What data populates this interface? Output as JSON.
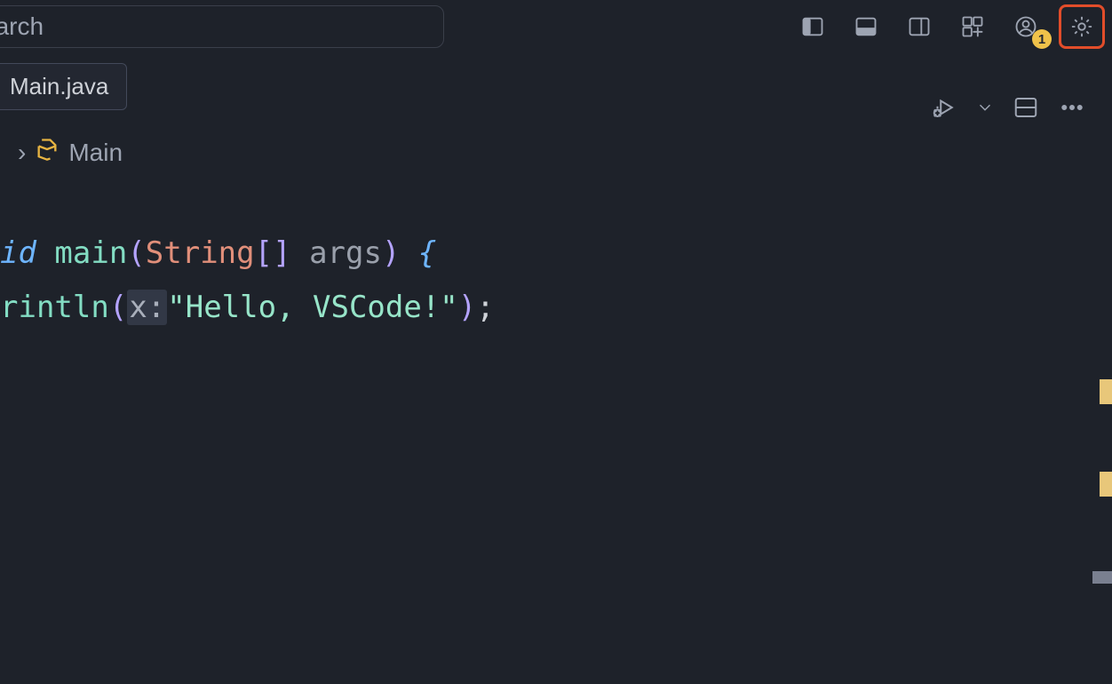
{
  "titlebar": {
    "search_placeholder": "earch",
    "account_badge": "1"
  },
  "tabs": {
    "active_label": "Main.java"
  },
  "breadcrumb": {
    "chevron": "›",
    "class_name": "Main"
  },
  "code": {
    "line1": {
      "prefix": "id ",
      "fn": "main",
      "open": "(",
      "type": "String",
      "brackets": "[]",
      "space": " ",
      "args": "args",
      "close_paren": ")",
      "space2": " ",
      "brace": "{"
    },
    "line2": {
      "prefix": "rintln",
      "open": "(",
      "inlay": "x:",
      "string": "\"Hello, VSCode!\"",
      "close_paren": ")",
      "semi": ";"
    }
  }
}
